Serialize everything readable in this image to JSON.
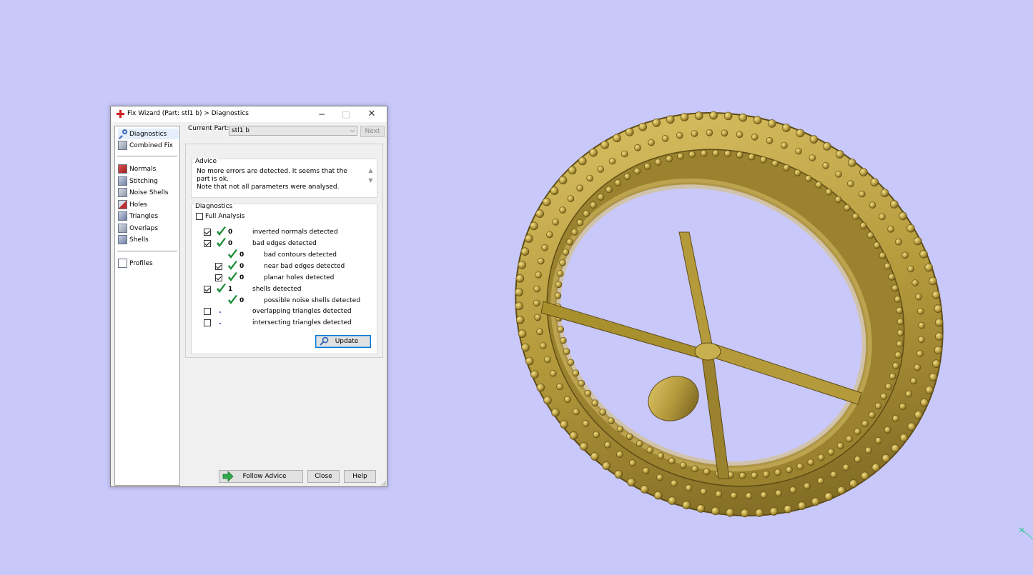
{
  "window": {
    "title": "Fix Wizard (Part: stl1 b) > Diagnostics",
    "controls": {
      "minimize": "−",
      "maximize": "□",
      "close": "✕"
    }
  },
  "nav": {
    "items": [
      {
        "label": "Diagnostics",
        "icon": "magnifier-icon",
        "selected": true
      },
      {
        "label": "Combined Fix",
        "icon": "combined-fix-icon"
      },
      {
        "label": "Normals",
        "icon": "normals-icon"
      },
      {
        "label": "Stitching",
        "icon": "stitching-icon"
      },
      {
        "label": "Noise Shells",
        "icon": "noise-shells-icon"
      },
      {
        "label": "Holes",
        "icon": "holes-icon"
      },
      {
        "label": "Triangles",
        "icon": "triangles-icon"
      },
      {
        "label": "Overlaps",
        "icon": "overlaps-icon"
      },
      {
        "label": "Shells",
        "icon": "shells-icon"
      },
      {
        "label": "Profiles",
        "icon": "profiles-icon"
      }
    ]
  },
  "current_part": {
    "label": "Current Part:",
    "value": "stl1 b",
    "next_label": "Next"
  },
  "advice": {
    "title": "Advice",
    "line1": "No more errors are detected. It seems that the part is ok.",
    "line2": "Note that not all parameters were analysed."
  },
  "diagnostics": {
    "title": "Diagnostics",
    "full_analysis_label": "Full Analysis",
    "rows": [
      {
        "checked": true,
        "status": "ok",
        "count": "0",
        "label": "inverted normals detected"
      },
      {
        "checked": true,
        "status": "ok",
        "count": "0",
        "label": "bad edges detected"
      },
      {
        "checked": null,
        "status": "ok",
        "count": "0",
        "label": "bad contours detected"
      },
      {
        "checked": true,
        "status": "ok",
        "count": "0",
        "label": "near bad edges detected"
      },
      {
        "checked": true,
        "status": "ok",
        "count": "0",
        "label": "planar holes detected"
      },
      {
        "checked": true,
        "status": "ok",
        "count": "1",
        "label": "shells detected"
      },
      {
        "checked": null,
        "status": "ok",
        "count": "0",
        "label": "possible noise shells detected"
      },
      {
        "checked": false,
        "status": "pending",
        "count": "",
        "label": "overlapping triangles detected"
      },
      {
        "checked": false,
        "status": "pending",
        "count": "",
        "label": "intersecting triangles detected"
      }
    ],
    "update_label": "Update"
  },
  "footer": {
    "follow_advice_label": "Follow Advice",
    "close_label": "Close",
    "help_label": "Help"
  },
  "colors": {
    "background": "#c8c8fa",
    "model_gold": "#b59a3c",
    "check_green": "#1f8f3a",
    "focus_blue": "#0078d7",
    "title_icon_red": "#d02020"
  }
}
